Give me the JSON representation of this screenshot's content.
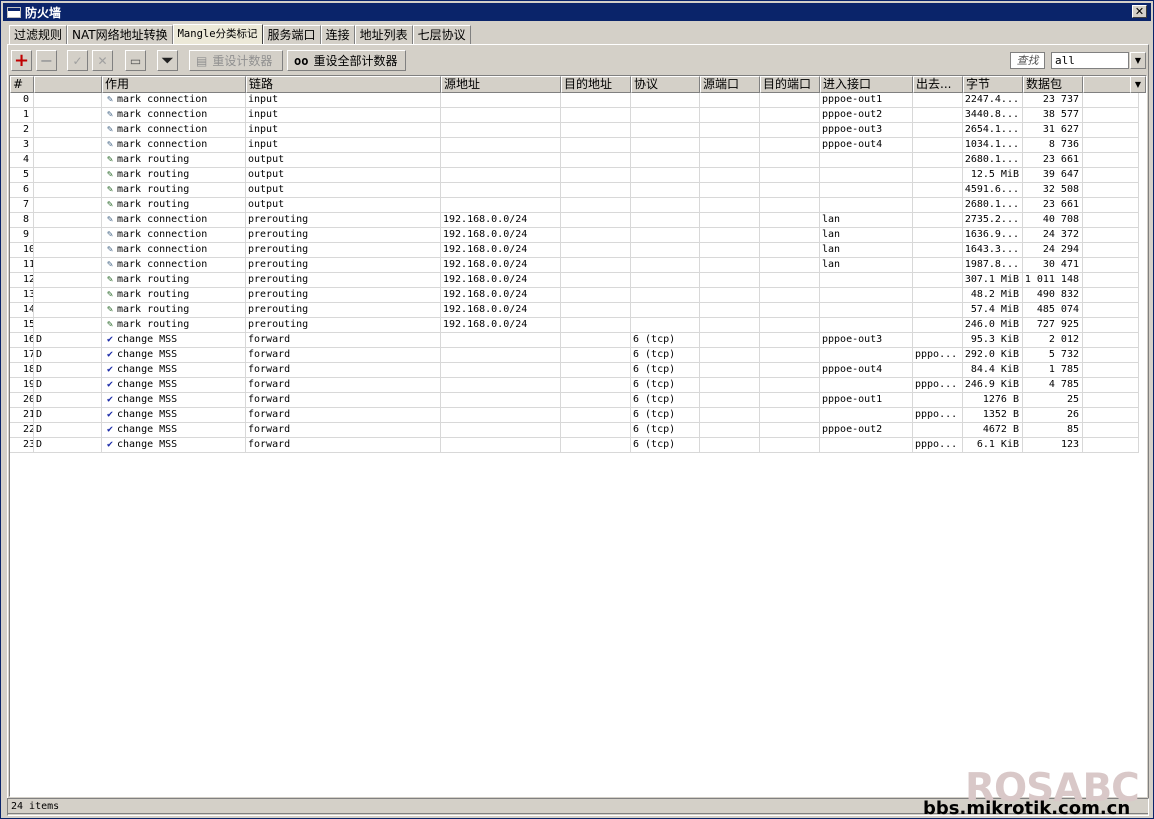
{
  "window": {
    "title": "防火墙",
    "close_label": "✕"
  },
  "tabs": [
    "过滤规则",
    "NAT网络地址转换",
    "Mangle分类标记",
    "服务端口",
    "连接",
    "地址列表",
    "七层协议"
  ],
  "toolbar": {
    "add": "+",
    "remove": "−",
    "enable": "✓",
    "disable": "✕",
    "comment": "▭",
    "filter": "⏷",
    "reset_counters": "重设计数器",
    "reset_all_counters_prefix": "oo",
    "reset_all_counters": "重设全部计数器",
    "search_label": "查找",
    "filter_value": "all"
  },
  "columns": [
    "#",
    "",
    "作用",
    "链路",
    "源地址",
    "目的地址",
    "协议",
    "源端口",
    "目的端口",
    "进入接口",
    "出去...",
    "字节",
    "数据包"
  ],
  "rows": [
    {
      "idx": "0",
      "flag": "",
      "icon": "pencil-light",
      "action": "mark connection",
      "chain": "input",
      "src": "",
      "proto": "",
      "in": "pppoe-out1",
      "out": "",
      "bytes": "2247.4...",
      "packets": "23 737"
    },
    {
      "idx": "1",
      "flag": "",
      "icon": "pencil-light",
      "action": "mark connection",
      "chain": "input",
      "src": "",
      "proto": "",
      "in": "pppoe-out2",
      "out": "",
      "bytes": "3440.8...",
      "packets": "38 577"
    },
    {
      "idx": "2",
      "flag": "",
      "icon": "pencil-light",
      "action": "mark connection",
      "chain": "input",
      "src": "",
      "proto": "",
      "in": "pppoe-out3",
      "out": "",
      "bytes": "2654.1...",
      "packets": "31 627"
    },
    {
      "idx": "3",
      "flag": "",
      "icon": "pencil-light",
      "action": "mark connection",
      "chain": "input",
      "src": "",
      "proto": "",
      "in": "pppoe-out4",
      "out": "",
      "bytes": "1034.1...",
      "packets": "8 736"
    },
    {
      "idx": "4",
      "flag": "",
      "icon": "pencil",
      "action": "mark routing",
      "chain": "output",
      "src": "",
      "proto": "",
      "in": "",
      "out": "",
      "bytes": "2680.1...",
      "packets": "23 661"
    },
    {
      "idx": "5",
      "flag": "",
      "icon": "pencil",
      "action": "mark routing",
      "chain": "output",
      "src": "",
      "proto": "",
      "in": "",
      "out": "",
      "bytes": "12.5 MiB",
      "packets": "39 647"
    },
    {
      "idx": "6",
      "flag": "",
      "icon": "pencil",
      "action": "mark routing",
      "chain": "output",
      "src": "",
      "proto": "",
      "in": "",
      "out": "",
      "bytes": "4591.6...",
      "packets": "32 508"
    },
    {
      "idx": "7",
      "flag": "",
      "icon": "pencil",
      "action": "mark routing",
      "chain": "output",
      "src": "",
      "proto": "",
      "in": "",
      "out": "",
      "bytes": "2680.1...",
      "packets": "23 661"
    },
    {
      "idx": "8",
      "flag": "",
      "icon": "pencil-light",
      "action": "mark connection",
      "chain": "prerouting",
      "src": "192.168.0.0/24",
      "proto": "",
      "in": "lan",
      "out": "",
      "bytes": "2735.2...",
      "packets": "40 708"
    },
    {
      "idx": "9",
      "flag": "",
      "icon": "pencil-light",
      "action": "mark connection",
      "chain": "prerouting",
      "src": "192.168.0.0/24",
      "proto": "",
      "in": "lan",
      "out": "",
      "bytes": "1636.9...",
      "packets": "24 372"
    },
    {
      "idx": "10",
      "flag": "",
      "icon": "pencil-light",
      "action": "mark connection",
      "chain": "prerouting",
      "src": "192.168.0.0/24",
      "proto": "",
      "in": "lan",
      "out": "",
      "bytes": "1643.3...",
      "packets": "24 294"
    },
    {
      "idx": "11",
      "flag": "",
      "icon": "pencil-light",
      "action": "mark connection",
      "chain": "prerouting",
      "src": "192.168.0.0/24",
      "proto": "",
      "in": "lan",
      "out": "",
      "bytes": "1987.8...",
      "packets": "30 471"
    },
    {
      "idx": "12",
      "flag": "",
      "icon": "pencil",
      "action": "mark routing",
      "chain": "prerouting",
      "src": "192.168.0.0/24",
      "proto": "",
      "in": "",
      "out": "",
      "bytes": "307.1 MiB",
      "packets": "1 011 148"
    },
    {
      "idx": "13",
      "flag": "",
      "icon": "pencil",
      "action": "mark routing",
      "chain": "prerouting",
      "src": "192.168.0.0/24",
      "proto": "",
      "in": "",
      "out": "",
      "bytes": "48.2 MiB",
      "packets": "490 832"
    },
    {
      "idx": "14",
      "flag": "",
      "icon": "pencil",
      "action": "mark routing",
      "chain": "prerouting",
      "src": "192.168.0.0/24",
      "proto": "",
      "in": "",
      "out": "",
      "bytes": "57.4 MiB",
      "packets": "485 074"
    },
    {
      "idx": "15",
      "flag": "",
      "icon": "pencil",
      "action": "mark routing",
      "chain": "prerouting",
      "src": "192.168.0.0/24",
      "proto": "",
      "in": "",
      "out": "",
      "bytes": "246.0 MiB",
      "packets": "727 925"
    },
    {
      "idx": "16",
      "flag": "D",
      "icon": "check",
      "action": "change MSS",
      "chain": "forward",
      "src": "",
      "proto": "6 (tcp)",
      "in": "pppoe-out3",
      "out": "",
      "bytes": "95.3 KiB",
      "packets": "2 012"
    },
    {
      "idx": "17",
      "flag": "D",
      "icon": "check",
      "action": "change MSS",
      "chain": "forward",
      "src": "",
      "proto": "6 (tcp)",
      "in": "",
      "out": "pppo...",
      "bytes": "292.0 KiB",
      "packets": "5 732"
    },
    {
      "idx": "18",
      "flag": "D",
      "icon": "check",
      "action": "change MSS",
      "chain": "forward",
      "src": "",
      "proto": "6 (tcp)",
      "in": "pppoe-out4",
      "out": "",
      "bytes": "84.4 KiB",
      "packets": "1 785"
    },
    {
      "idx": "19",
      "flag": "D",
      "icon": "check",
      "action": "change MSS",
      "chain": "forward",
      "src": "",
      "proto": "6 (tcp)",
      "in": "",
      "out": "pppo...",
      "bytes": "246.9 KiB",
      "packets": "4 785"
    },
    {
      "idx": "20",
      "flag": "D",
      "icon": "check",
      "action": "change MSS",
      "chain": "forward",
      "src": "",
      "proto": "6 (tcp)",
      "in": "pppoe-out1",
      "out": "",
      "bytes": "1276 B",
      "packets": "25"
    },
    {
      "idx": "21",
      "flag": "D",
      "icon": "check",
      "action": "change MSS",
      "chain": "forward",
      "src": "",
      "proto": "6 (tcp)",
      "in": "",
      "out": "pppo...",
      "bytes": "1352 B",
      "packets": "26"
    },
    {
      "idx": "22",
      "flag": "D",
      "icon": "check",
      "action": "change MSS",
      "chain": "forward",
      "src": "",
      "proto": "6 (tcp)",
      "in": "pppoe-out2",
      "out": "",
      "bytes": "4672 B",
      "packets": "85"
    },
    {
      "idx": "23",
      "flag": "D",
      "icon": "check",
      "action": "change MSS",
      "chain": "forward",
      "src": "",
      "proto": "6 (tcp)",
      "in": "",
      "out": "pppo...",
      "bytes": "6.1 KiB",
      "packets": "123"
    }
  ],
  "status": "24 items",
  "watermark": {
    "logo": "ROSABC",
    "url": "bbs.mikrotik.com.cn"
  }
}
